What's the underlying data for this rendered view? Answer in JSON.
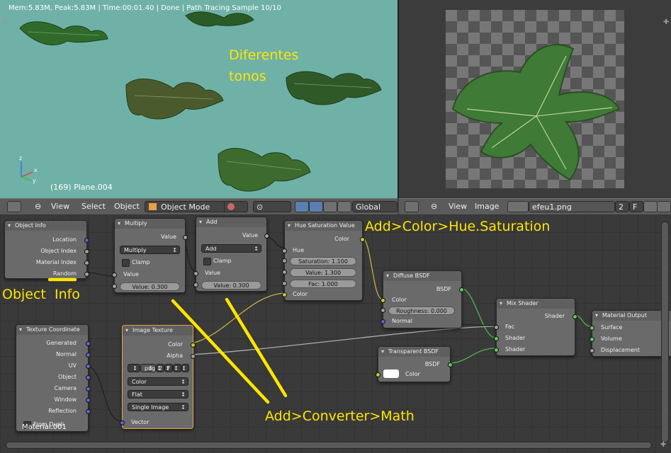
{
  "viewport": {
    "status": "Mem:5.83M, Peak:5.83M | Time:00:01.40 | Done | Path Tracing Sample 10/10",
    "object_label": "(169) Plane.004",
    "annotation_tones": "Diferentes\ntonos",
    "axis_x": "x",
    "axis_y": "y",
    "axis_z": "z"
  },
  "view3d_header": {
    "menu_view": "View",
    "menu_select": "Select",
    "menu_object": "Object",
    "mode": "Object Mode",
    "orientation": "Global"
  },
  "image_header": {
    "menu_view": "View",
    "menu_image": "Image",
    "image_name": "efeu1.png",
    "users": "2",
    "fake": "F"
  },
  "annotations": {
    "hue_sat": "Add>Color>Hue.Saturation",
    "object_info": "Object  Info",
    "math": "Add>Converter>Math"
  },
  "nodes": {
    "object_info": {
      "title": "Object Info",
      "outputs": [
        "Location",
        "Object Index",
        "Material Index",
        "Random"
      ]
    },
    "multiply": {
      "title": "Multiply",
      "out": "Value",
      "op": "Multiply",
      "clamp": "Clamp",
      "in": "Value",
      "value": "Value: 0.300"
    },
    "add": {
      "title": "Add",
      "out": "Value",
      "op": "Add",
      "clamp": "Clamp",
      "in": "Value",
      "value": "Value: 0.300"
    },
    "hsv": {
      "title": "Hue Saturation Value",
      "out": "Color",
      "hue": "Hue",
      "saturation": "Saturation: 1.100",
      "value": "Value: 1.300",
      "fac": "Fac: 1.000",
      "color": "Color"
    },
    "diffuse": {
      "title": "Diffuse BSDF",
      "out": "BSDF",
      "color": "Color",
      "roughness": "Roughness: 0.000",
      "normal": "Normal"
    },
    "transparent": {
      "title": "Transparent BSDF",
      "out": "BSDF",
      "color": "Color"
    },
    "mix": {
      "title": "Mix Shader",
      "out": "Shader",
      "fac": "Fac",
      "shader1": "Shader",
      "shader2": "Shader"
    },
    "output": {
      "title": "Material Output",
      "surface": "Surface",
      "volume": "Volume",
      "displacement": "Displacement"
    },
    "texcoord": {
      "title": "Texture Coordinate",
      "outputs": [
        "Generated",
        "Normal",
        "UV",
        "Object",
        "Camera",
        "Window",
        "Reflection"
      ],
      "from_dupli": "From Dupli"
    },
    "image_tex": {
      "title": "Image Texture",
      "color": "Color",
      "alpha": "Alpha",
      "img": "png",
      "users": "2",
      "fake": "F",
      "color_space": "Color",
      "projection": "Flat",
      "extension": "Single Image",
      "vector": "Vector"
    }
  },
  "material_label": "Material.001",
  "colors": {
    "annotation": "#ffe600",
    "viewport_bg": "#6fb1a6",
    "selected_node": "#e8a440"
  }
}
